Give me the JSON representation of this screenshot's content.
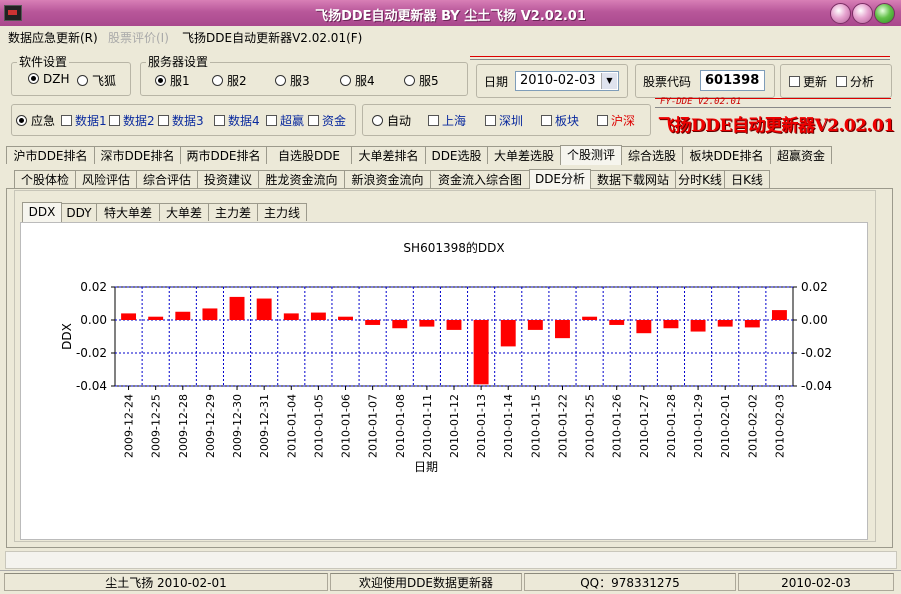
{
  "window": {
    "title": "飞扬DDE自动更新器 BY 尘土飞扬 V2.02.01"
  },
  "menu": [
    {
      "label": "数据应急更新(R)",
      "enabled": true
    },
    {
      "label": "股票评价(I)",
      "enabled": false
    },
    {
      "label": "飞扬DDE自动更新器V2.02.01(F)",
      "enabled": true
    }
  ],
  "software_settings": {
    "label": "软件设置",
    "options": [
      {
        "label": "DZH",
        "selected": true
      },
      {
        "label": "飞狐",
        "selected": false
      }
    ]
  },
  "server_settings": {
    "label": "服务器设置",
    "options": [
      {
        "label": "服1",
        "selected": true
      },
      {
        "label": "服2",
        "selected": false
      },
      {
        "label": "服3",
        "selected": false
      },
      {
        "label": "服4",
        "selected": false
      },
      {
        "label": "服5",
        "selected": false
      }
    ]
  },
  "date_field": {
    "label": "日期",
    "value": "2010-02-03"
  },
  "stock_code": {
    "label": "股票代码",
    "value": "601398"
  },
  "options_checks": [
    {
      "label": "更新",
      "checked": false
    },
    {
      "label": "分析",
      "checked": false
    }
  ],
  "data_source": {
    "radio": {
      "label": "应急",
      "selected": true
    },
    "checks": [
      {
        "label": "数据1",
        "checked": false
      },
      {
        "label": "数据2",
        "checked": false
      },
      {
        "label": "数据3",
        "checked": false
      },
      {
        "label": "数据4",
        "checked": false
      },
      {
        "label": "超赢",
        "checked": false
      },
      {
        "label": "资金",
        "checked": false
      }
    ]
  },
  "market": {
    "radio": {
      "label": "自动",
      "selected": false
    },
    "checks": [
      {
        "label": "上海",
        "checked": false,
        "color": "#0a2a9e"
      },
      {
        "label": "深圳",
        "checked": false,
        "color": "#0a2a9e"
      },
      {
        "label": "板块",
        "checked": false,
        "color": "#0a2a9e"
      },
      {
        "label": "沪深",
        "checked": false,
        "color": "#dd0000"
      }
    ]
  },
  "logo": {
    "small": "FY-DDE V2.02.01",
    "big": "飞扬DDE自动更新器V2.02.01"
  },
  "tabs_row1": [
    "沪市DDE排名",
    "深市DDE排名",
    "两市DDE排名",
    "自选股DDE",
    "大单差排名",
    "DDE选股",
    "大单差选股",
    "个股测评",
    "综合选股",
    "板块DDE排名",
    "超赢资金"
  ],
  "tabs_row1_active": 7,
  "tabs_row2": [
    "个股体检",
    "风险评估",
    "综合评估",
    "投资建议",
    "胜龙资金流向",
    "新浪资金流向",
    "资金流入综合图",
    "DDE分析",
    "数据下载网站",
    "分时K线",
    "日K线"
  ],
  "tabs_row2_active": 7,
  "tabs_row3": [
    "DDX",
    "DDY",
    "特大单差",
    "大单差",
    "主力差",
    "主力线"
  ],
  "tabs_row3_active": 0,
  "chart_data": {
    "type": "bar",
    "title": "SH601398的DDX",
    "xlabel": "日期",
    "ylabel": "DDX",
    "ylim": [
      -0.04,
      0.02
    ],
    "yticks": [
      0.02,
      0.0,
      -0.02,
      -0.04
    ],
    "ytick_labels": [
      "0.02",
      "0.00",
      "-0.02",
      "-0.04"
    ],
    "grid": true,
    "bar_color": "#ff0000",
    "categories": [
      "2009-12-24",
      "2009-12-25",
      "2009-12-28",
      "2009-12-29",
      "2009-12-30",
      "2009-12-31",
      "2010-01-04",
      "2010-01-05",
      "2010-01-06",
      "2010-01-07",
      "2010-01-08",
      "2010-01-11",
      "2010-01-12",
      "2010-01-13",
      "2010-01-14",
      "2010-01-15",
      "2010-01-22",
      "2010-01-25",
      "2010-01-26",
      "2010-01-27",
      "2010-01-28",
      "2010-01-29",
      "2010-02-01",
      "2010-02-02",
      "2010-02-03"
    ],
    "values": [
      0.004,
      0.002,
      0.005,
      0.007,
      0.014,
      0.013,
      0.004,
      0.0045,
      0.002,
      -0.003,
      -0.005,
      -0.004,
      -0.006,
      -0.039,
      -0.016,
      -0.006,
      -0.011,
      0.002,
      -0.003,
      -0.008,
      -0.005,
      -0.007,
      -0.004,
      -0.0045,
      0.006
    ]
  },
  "status": [
    "尘土飞扬 2010-02-01",
    "欢迎使用DDE数据更新器",
    "QQ：978331275",
    "2010-02-03"
  ]
}
